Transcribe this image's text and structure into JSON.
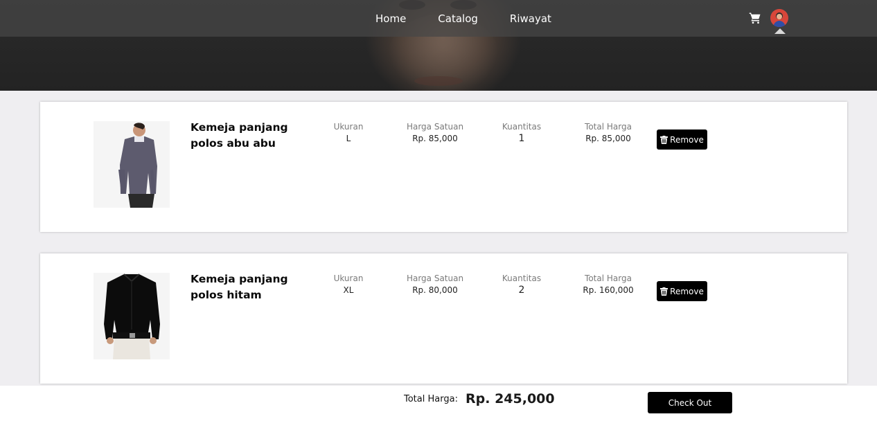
{
  "nav": {
    "links": [
      "Home",
      "Catalog",
      "Riwayat"
    ],
    "cart_icon": "cart-icon",
    "avatar_icon": "user-avatar"
  },
  "columns": {
    "size": "Ukuran",
    "unit_price": "Harga Satuan",
    "quantity": "Kuantitas",
    "total": "Total Harga"
  },
  "cart": {
    "items": [
      {
        "name_line1": "Kemeja panjang",
        "name_line2": "polos abu abu",
        "size": "L",
        "unit_price": "Rp. 85,000",
        "quantity": "1",
        "total": "Rp. 85,000",
        "remove_label": "Remove",
        "shirt_color": "#5d5b6e"
      },
      {
        "name_line1": "Kemeja panjang",
        "name_line2": "polos hitam",
        "size": "XL",
        "unit_price": "Rp. 80,000",
        "quantity": "2",
        "total": "Rp. 160,000",
        "remove_label": "Remove",
        "shirt_color": "#0c0c0c"
      }
    ]
  },
  "footer": {
    "total_label": "Total Harga:",
    "total_value": "Rp. 245,000",
    "checkout_label": "Check Out"
  },
  "colors": {
    "page_bg": "#efeef1",
    "button_bg": "#000000",
    "button_text": "#ffffff"
  }
}
